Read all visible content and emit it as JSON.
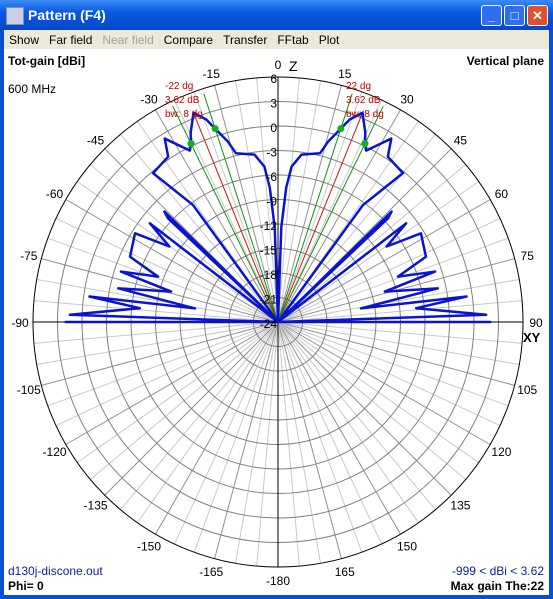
{
  "window": {
    "title": "Pattern   (F4)",
    "minimize": "_",
    "maximize": "□",
    "close": "✕",
    "icon": "pattern-icon"
  },
  "menu": [
    {
      "label": "Show",
      "enabled": true
    },
    {
      "label": "Far field",
      "enabled": true
    },
    {
      "label": "Near field",
      "enabled": false
    },
    {
      "label": "Compare",
      "enabled": true
    },
    {
      "label": "Transfer",
      "enabled": true
    },
    {
      "label": "FFtab",
      "enabled": true
    },
    {
      "label": "Plot",
      "enabled": true
    }
  ],
  "header": {
    "quantity": "Tot-gain [dBi]",
    "frequency": "600 MHz",
    "plane": "Vertical plane",
    "z_axis": "Z",
    "xy_axis": "XY"
  },
  "footer": {
    "file": "d130j-discone.out",
    "phi": "Phi= 0",
    "range": "-999 < dBi < 3.62",
    "max_gain": "Max gain The:22"
  },
  "annotation": {
    "left": [
      "-22 dg",
      "3.62 dB",
      "bw: 8 dg"
    ],
    "right": [
      "22 dg",
      "3.62 dB",
      "bw: 8 dg"
    ]
  },
  "chart_data": {
    "type": "polar-line",
    "radial_min_dbi": -24,
    "radial_max_dbi": 6,
    "radial_ticks": [
      "6",
      "3",
      "0",
      "-3",
      "-6",
      "-9",
      "-12",
      "-15",
      "-18",
      "-21",
      "-24"
    ],
    "angle_ticks": [
      "0",
      "15",
      "30",
      "45",
      "60",
      "75",
      "90",
      "105",
      "120",
      "135",
      "150",
      "165",
      "-180",
      "-165",
      "-150",
      "-135",
      "-120",
      "-105",
      "-90",
      "-75",
      "-60",
      "-45",
      "-30",
      "-15"
    ],
    "angle_tick_values": [
      0,
      15,
      30,
      45,
      60,
      75,
      90,
      105,
      120,
      135,
      150,
      165,
      180,
      -165,
      -150,
      -135,
      -120,
      -105,
      -90,
      -75,
      -60,
      -45,
      -30,
      -15
    ],
    "grid": true,
    "series_color": "#0a14d0",
    "max_gain_dbi": 3.62,
    "max_gain_theta": 22,
    "beamwidth_deg": 8,
    "halfpower_markers_theta": [
      18,
      26,
      -18,
      -26
    ],
    "colors": {
      "max_line": "#d01010",
      "bw_lines": "#109010",
      "markers": "#10b020",
      "annotation": "#c00000"
    },
    "pattern": [
      [
        0,
        -24
      ],
      [
        2,
        -12.4
      ],
      [
        3.5,
        -7.5
      ],
      [
        5,
        -4.9
      ],
      [
        8,
        -3.3
      ],
      [
        14,
        -2.7
      ],
      [
        15.5,
        -1.1
      ],
      [
        18,
        0.9
      ],
      [
        19.5,
        2.3
      ],
      [
        22,
        3.62
      ],
      [
        24.8,
        1.5
      ],
      [
        26,
        0.3
      ],
      [
        27.2,
        -0.4
      ],
      [
        31.7,
        2.4
      ],
      [
        33.6,
        0.3
      ],
      [
        40,
        -0.2
      ],
      [
        36,
        -6.3
      ],
      [
        38,
        -24
      ],
      [
        45.8,
        -4.6
      ],
      [
        46.7,
        -5.5
      ],
      [
        48,
        -24
      ],
      [
        52.4,
        -4.2
      ],
      [
        55.2,
        -7.8
      ],
      [
        58.2,
        -3.4
      ],
      [
        66.2,
        -4.2
      ],
      [
        69.3,
        -8.3
      ],
      [
        72.2,
        -3.8
      ],
      [
        74.1,
        -10.4
      ],
      [
        78.1,
        -4.0
      ],
      [
        80.7,
        -13.7
      ],
      [
        82.3,
        -0.7
      ],
      [
        84.3,
        -7
      ],
      [
        88,
        1.5
      ],
      [
        89,
        -24
      ],
      [
        90,
        2
      ],
      [
        90,
        -24
      ],
      [
        -2,
        -12.4
      ],
      [
        -3.5,
        -7.5
      ],
      [
        -5,
        -4.9
      ],
      [
        -8,
        -3.3
      ],
      [
        -14,
        -2.7
      ],
      [
        -15.5,
        -1.1
      ],
      [
        -18,
        0.9
      ],
      [
        -19.5,
        2.3
      ],
      [
        -22,
        3.62
      ],
      [
        -24.8,
        1.5
      ],
      [
        -26,
        0.3
      ],
      [
        -27.2,
        -0.4
      ],
      [
        -31.7,
        2.4
      ],
      [
        -33.6,
        0.3
      ],
      [
        -40,
        -0.2
      ],
      [
        -36,
        -6.3
      ],
      [
        -38,
        -24
      ],
      [
        -45.8,
        -4.6
      ],
      [
        -46.7,
        -5.5
      ],
      [
        -48,
        -24
      ],
      [
        -52.4,
        -4.2
      ],
      [
        -55.2,
        -7.8
      ],
      [
        -58.2,
        -3.4
      ],
      [
        -66.2,
        -4.2
      ],
      [
        -69.3,
        -8.3
      ],
      [
        -72.2,
        -3.8
      ],
      [
        -74.1,
        -10.4
      ],
      [
        -78.1,
        -4.0
      ],
      [
        -80.7,
        -13.7
      ],
      [
        -82.3,
        -0.7
      ],
      [
        -84.3,
        -7
      ],
      [
        -88,
        1.5
      ],
      [
        -89,
        -24
      ],
      [
        -90,
        2
      ],
      [
        -90,
        -24
      ]
    ]
  }
}
